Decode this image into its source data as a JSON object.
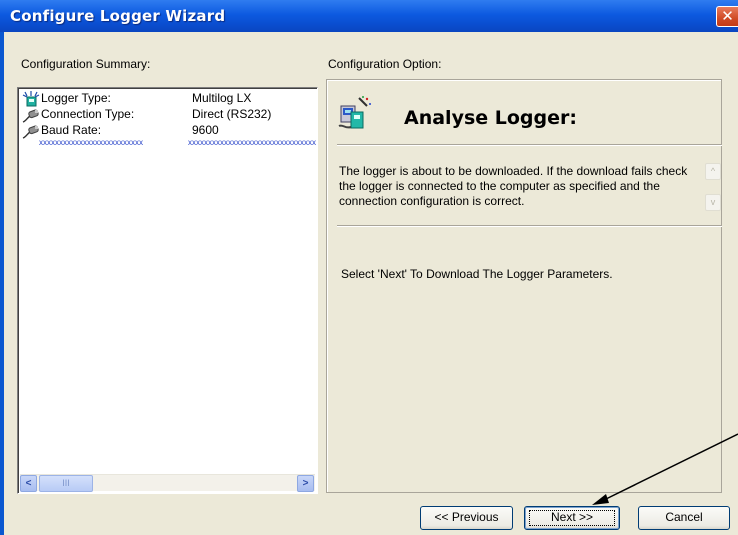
{
  "window": {
    "title": "Configure Logger Wizard",
    "close_glyph": "✕"
  },
  "summary": {
    "label": "Configuration Summary:",
    "rows": [
      {
        "icon": "logger-icon",
        "label": "Logger Type:",
        "value": "Multilog LX"
      },
      {
        "icon": "cable-icon",
        "label": "Connection Type:",
        "value": "Direct (RS232)"
      },
      {
        "icon": "cable-icon",
        "label": "Baud Rate:",
        "value": "9600"
      }
    ],
    "separator_left": "xxxxxxxxxxxxxxxxxxxxxxxxxx",
    "separator_right": "xxxxxxxxxxxxxxxxxxxxxxxxxxxxxxxx"
  },
  "option": {
    "label": "Configuration Option:",
    "heading": "Analyse Logger:",
    "icon": "analyse-logger-icon",
    "info": "The logger is about to be downloaded. If the download fails check the logger is connected to the computer as specified and the connection configuration is correct.",
    "instruction": "Select 'Next' To Download The Logger Parameters."
  },
  "buttons": {
    "previous": "<< Previous",
    "next": "Next >>",
    "cancel": "Cancel"
  },
  "scroll": {
    "left": "<",
    "right": ">",
    "thumb_grip": "III",
    "up": "^",
    "down": "v"
  },
  "colors": {
    "titlebar": "#0a4ed0",
    "dialog_bg": "#ece9d8",
    "close_button": "#d04b26",
    "separator_stars": "#2440c8"
  }
}
